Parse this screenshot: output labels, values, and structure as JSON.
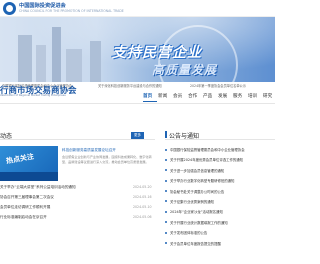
{
  "header": {
    "org_name": "中国国际投资促进会",
    "org_name_en": "CHINA COUNCIL FOR THE PROMOTION OF INTERNATIONAL TRADE"
  },
  "banner": {
    "slogan_line1": "支持民营企业",
    "slogan_line2": "高质量发展"
  },
  "site": {
    "title": "行商市场交易商协会",
    "subtitle": "Association of Regional Market Trading Enterprises"
  },
  "ticker": [
    "中国银行保险监督管理委员会和中小企业管理协会",
    "关于深化科技创新服务平台建设与合作的通知",
    "2024年第一季度协会会员单位名单公示"
  ],
  "nav": {
    "items": [
      "首页",
      "新闻",
      "会员",
      "合作",
      "产品",
      "发展",
      "服务",
      "培训",
      "研究"
    ]
  },
  "left": {
    "section_title": "动态",
    "more_label": "更多",
    "featured": {
      "image_text": "热点关注",
      "title": "科技创新服务高质量发展论坛召开",
      "desc": "会议聚焦企业创新与产业协同发展，围绕科技成果转化、数字化转型、品牌建设等议题进行深入交流，推动会员单位高质量发展。"
    },
    "news": [
      {
        "title": "关于举办“云端大讲堂”系列公益培训活动的通知",
        "date": "2024-05-20"
      },
      {
        "title": "协会召开第三届理事会第二次会议",
        "date": "2024-05-16"
      },
      {
        "title": "会员单位走访调研工作顺利开展",
        "date": "2024-05-10"
      },
      {
        "title": "行业标准编制启动会在京召开",
        "date": "2024-05-06"
      }
    ]
  },
  "right": {
    "section_title": "公告与通知",
    "items": [
      "中国银行保险监督管理委员会和中小企业管理协会",
      "关于开展2024年度优秀会员单位评选工作的通知",
      "关于进一步加强会员信息管理的通知",
      "关于举办行业数字化转型专题研修班的通知",
      "协会秘书处关于调整办公时间的公告",
      "关于征集行业优秀案例的通知",
      "2024年“企业家沙龙”活动报名通知",
      "关于开展行业统计数据填报工作的通知",
      "关于发布团体标准的公告",
      "关于会员单位年度报告提交的提醒"
    ]
  },
  "colors": {
    "accent": "#1e64b4",
    "title_blue": "#1f5aa6"
  }
}
